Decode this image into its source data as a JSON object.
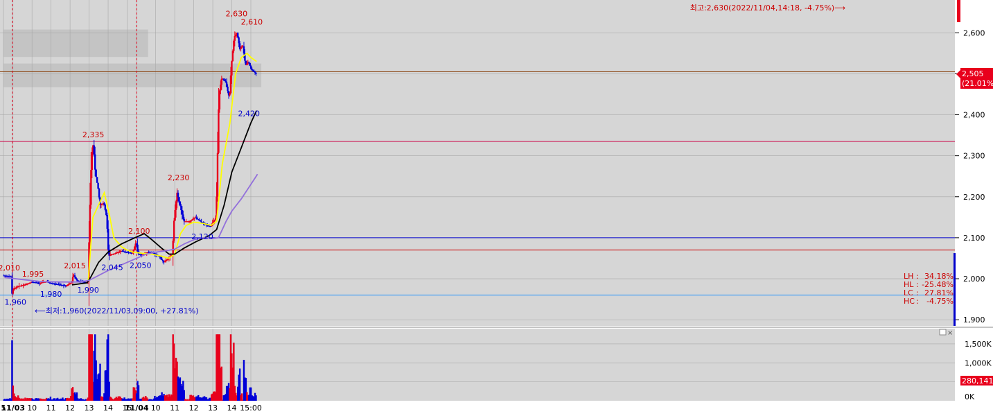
{
  "chart_data": {
    "type": "candlestick",
    "title": "",
    "price_axis": {
      "ylim": [
        1885,
        2680
      ],
      "ticks": [
        1900,
        2000,
        2100,
        2200,
        2300,
        2400,
        2500,
        2600
      ],
      "tick_labels": [
        "1,900",
        "2,000",
        "2,100",
        "2,200",
        "2,300",
        "2,400",
        "2,500",
        "2,600"
      ]
    },
    "volume_axis": {
      "ylim": [
        0,
        1900000
      ],
      "ticks": [
        0,
        500000,
        1000000,
        1500000
      ],
      "tick_labels": [
        "0K",
        "500K",
        "1,000K",
        "1,500K"
      ]
    },
    "x_axis": {
      "range": [
        0,
        26
      ],
      "ticks": [
        {
          "x": 0,
          "label": "5"
        },
        {
          "x": 0.5,
          "label": "11/03"
        },
        {
          "x": 1.5,
          "label": "10"
        },
        {
          "x": 2.5,
          "label": "11"
        },
        {
          "x": 3.5,
          "label": "12"
        },
        {
          "x": 4.5,
          "label": "13"
        },
        {
          "x": 5.5,
          "label": "14"
        },
        {
          "x": 6.5,
          "label": "15"
        },
        {
          "x": 7,
          "label": "11/04"
        },
        {
          "x": 8,
          "label": "10"
        },
        {
          "x": 9,
          "label": "11"
        },
        {
          "x": 10,
          "label": "12"
        },
        {
          "x": 11,
          "label": "13"
        },
        {
          "x": 12,
          "label": "14"
        },
        {
          "x": 13,
          "label": "15:00"
        }
      ]
    },
    "day_separators": [
      0.47,
      7.0
    ],
    "price_path": [
      [
        0,
        2008
      ],
      [
        0.45,
        2005
      ],
      [
        0.47,
        1962
      ],
      [
        0.55,
        1975
      ],
      [
        0.8,
        1982
      ],
      [
        1.2,
        1986
      ],
      [
        1.5,
        1992
      ],
      [
        1.9,
        1990
      ],
      [
        2.3,
        1993
      ],
      [
        2.5,
        1989
      ],
      [
        2.9,
        1986
      ],
      [
        3.3,
        1983
      ],
      [
        3.6,
        1990
      ],
      [
        3.7,
        2010
      ],
      [
        3.9,
        1995
      ],
      [
        4.1,
        1993
      ],
      [
        4.4,
        1992
      ],
      [
        4.47,
        1994
      ],
      [
        4.55,
        2140
      ],
      [
        4.65,
        2300
      ],
      [
        4.75,
        2330
      ],
      [
        4.85,
        2260
      ],
      [
        5.0,
        2220
      ],
      [
        5.1,
        2180
      ],
      [
        5.3,
        2185
      ],
      [
        5.45,
        2150
      ],
      [
        5.55,
        2055
      ],
      [
        5.7,
        2060
      ],
      [
        5.9,
        2062
      ],
      [
        6.2,
        2068
      ],
      [
        6.5,
        2065
      ],
      [
        6.8,
        2062
      ],
      [
        7.0,
        2090
      ],
      [
        7.1,
        2060
      ],
      [
        7.3,
        2058
      ],
      [
        7.6,
        2065
      ],
      [
        7.9,
        2063
      ],
      [
        8.2,
        2055
      ],
      [
        8.45,
        2040
      ],
      [
        8.7,
        2050
      ],
      [
        8.9,
        2058
      ],
      [
        9.0,
        2150
      ],
      [
        9.15,
        2210
      ],
      [
        9.3,
        2180
      ],
      [
        9.5,
        2140
      ],
      [
        9.8,
        2140
      ],
      [
        10.1,
        2150
      ],
      [
        10.5,
        2135
      ],
      [
        10.9,
        2128
      ],
      [
        11.2,
        2150
      ],
      [
        11.35,
        2450
      ],
      [
        11.5,
        2490
      ],
      [
        11.7,
        2480
      ],
      [
        11.9,
        2440
      ],
      [
        12.0,
        2520
      ],
      [
        12.15,
        2590
      ],
      [
        12.3,
        2600
      ],
      [
        12.45,
        2560
      ],
      [
        12.6,
        2570
      ],
      [
        12.75,
        2520
      ],
      [
        12.9,
        2530
      ],
      [
        13.05,
        2510
      ],
      [
        13.2,
        2505
      ],
      [
        13.3,
        2500
      ]
    ],
    "moving_averages": [
      {
        "color": "#ffff00",
        "values": [
          [
            4.45,
            1993
          ],
          [
            4.7,
            2150
          ],
          [
            4.95,
            2175
          ],
          [
            5.3,
            2210
          ],
          [
            5.55,
            2160
          ],
          [
            5.8,
            2100
          ],
          [
            6.2,
            2078
          ],
          [
            6.5,
            2070
          ],
          [
            6.8,
            2065
          ],
          [
            7.3,
            2062
          ],
          [
            7.8,
            2060
          ],
          [
            8.3,
            2055
          ],
          [
            8.7,
            2050
          ],
          [
            9.0,
            2060
          ],
          [
            9.3,
            2110
          ],
          [
            9.6,
            2130
          ],
          [
            10.0,
            2138
          ],
          [
            10.5,
            2135
          ],
          [
            10.9,
            2130
          ],
          [
            11.2,
            2140
          ],
          [
            11.5,
            2280
          ],
          [
            11.9,
            2380
          ],
          [
            12.2,
            2500
          ],
          [
            12.5,
            2540
          ],
          [
            12.8,
            2550
          ],
          [
            13.0,
            2540
          ],
          [
            13.3,
            2530
          ]
        ]
      },
      {
        "color": "#000000",
        "values": [
          [
            3.6,
            1985
          ],
          [
            4.4,
            1990
          ],
          [
            4.6,
            2005
          ],
          [
            5.0,
            2040
          ],
          [
            5.5,
            2065
          ],
          [
            6.2,
            2085
          ],
          [
            6.9,
            2100
          ],
          [
            7.4,
            2110
          ],
          [
            7.8,
            2095
          ],
          [
            8.3,
            2075
          ],
          [
            8.7,
            2060
          ],
          [
            9.0,
            2060
          ],
          [
            9.5,
            2075
          ],
          [
            10.1,
            2090
          ],
          [
            10.8,
            2105
          ],
          [
            11.2,
            2120
          ],
          [
            11.6,
            2180
          ],
          [
            12.0,
            2260
          ],
          [
            12.5,
            2320
          ],
          [
            13.0,
            2380
          ],
          [
            13.3,
            2410
          ]
        ]
      },
      {
        "color": "#9370db",
        "values": [
          [
            0.05,
            2003
          ],
          [
            1.0,
            1998
          ],
          [
            2.0,
            1993
          ],
          [
            3.0,
            1992
          ],
          [
            4.0,
            1992
          ],
          [
            4.5,
            1996
          ],
          [
            5.0,
            2008
          ],
          [
            5.5,
            2020
          ],
          [
            6.0,
            2030
          ],
          [
            6.5,
            2040
          ],
          [
            7.0,
            2050
          ],
          [
            7.5,
            2060
          ],
          [
            8.0,
            2065
          ],
          [
            8.5,
            2068
          ],
          [
            9.0,
            2072
          ],
          [
            9.5,
            2085
          ],
          [
            10.0,
            2095
          ],
          [
            10.5,
            2100
          ],
          [
            11.0,
            2098
          ],
          [
            11.3,
            2100
          ],
          [
            11.7,
            2140
          ],
          [
            12.0,
            2165
          ],
          [
            12.5,
            2195
          ],
          [
            13.0,
            2230
          ],
          [
            13.35,
            2255
          ]
        ]
      }
    ],
    "horizontal_lines": [
      {
        "y": 2505,
        "color": "#8b4513"
      },
      {
        "y": 2335,
        "color": "#cc0044"
      },
      {
        "y": 2100,
        "color": "#0000cc"
      },
      {
        "y": 2070,
        "color": "#cc0000"
      },
      {
        "y": 1960,
        "color": "#1e90ff"
      }
    ],
    "grey_bands": [
      {
        "x0": 0,
        "x1": 7.6,
        "y0": 2541,
        "y1": 2608
      },
      {
        "x0": 0,
        "x1": 13.55,
        "y0": 2467,
        "y1": 2525
      }
    ],
    "annotations": [
      {
        "x": 0.3,
        "y": 2010,
        "text": "2,010",
        "color": "#cc0000",
        "pos": "above"
      },
      {
        "x": 0.63,
        "y": 1960,
        "text": "1,960",
        "color": "#0000cc",
        "pos": "below"
      },
      {
        "x": 1.55,
        "y": 1995,
        "text": "1,995",
        "color": "#cc0000",
        "pos": "above"
      },
      {
        "x": 2.5,
        "y": 1980,
        "text": "1,980",
        "color": "#0000cc",
        "pos": "below"
      },
      {
        "x": 3.75,
        "y": 2015,
        "text": "2,015",
        "color": "#cc0000",
        "pos": "above"
      },
      {
        "x": 4.45,
        "y": 1990,
        "text": "1,990",
        "color": "#0000cc",
        "pos": "below"
      },
      {
        "x": 4.72,
        "y": 2335,
        "text": "2,335",
        "color": "#cc0000",
        "pos": "above"
      },
      {
        "x": 5.72,
        "y": 2045,
        "text": "2,045",
        "color": "#0000cc",
        "pos": "below"
      },
      {
        "x": 7.13,
        "y": 2100,
        "text": "2,100",
        "color": "#cc0000",
        "pos": "above"
      },
      {
        "x": 7.2,
        "y": 2050,
        "text": "2,050",
        "color": "#0000cc",
        "pos": "below"
      },
      {
        "x": 9.2,
        "y": 2230,
        "text": "2,230",
        "color": "#cc0000",
        "pos": "above"
      },
      {
        "x": 10.45,
        "y": 2120,
        "text": "2,120",
        "color": "#0000cc",
        "pos": "below"
      },
      {
        "x": 12.25,
        "y": 2630,
        "text": "2,630",
        "color": "#cc0000",
        "pos": "above"
      },
      {
        "x": 13.05,
        "y": 2610,
        "text": "2,610",
        "color": "#cc0000",
        "pos": "above"
      },
      {
        "x": 12.9,
        "y": 2420,
        "text": "2,420",
        "color": "#0000cc",
        "pos": "below"
      }
    ],
    "extreme_labels": {
      "high": "최고:2,630(2022/11/04,14:18, -4.75%)⟶",
      "low": "⟵최저:1,960(2022/11/03,09:00, +27.81%)"
    },
    "current_price": {
      "value": 2505,
      "label": "2,505",
      "change": "(21.01%)"
    },
    "stats": [
      {
        "key": "LH",
        "value": "34.18%"
      },
      {
        "key": "HL",
        "value": "-25.48%"
      },
      {
        "key": "LC",
        "value": "27.81%"
      },
      {
        "key": "HC",
        "value": "-4.75%"
      }
    ],
    "volume_current": {
      "value": 280141,
      "label": "280,141"
    },
    "colors": {
      "up": "#e8001c",
      "down": "#0000d8",
      "background": "#d6d6d6",
      "axis_background": "#ffffff",
      "grid": "#a8a8a8"
    }
  }
}
